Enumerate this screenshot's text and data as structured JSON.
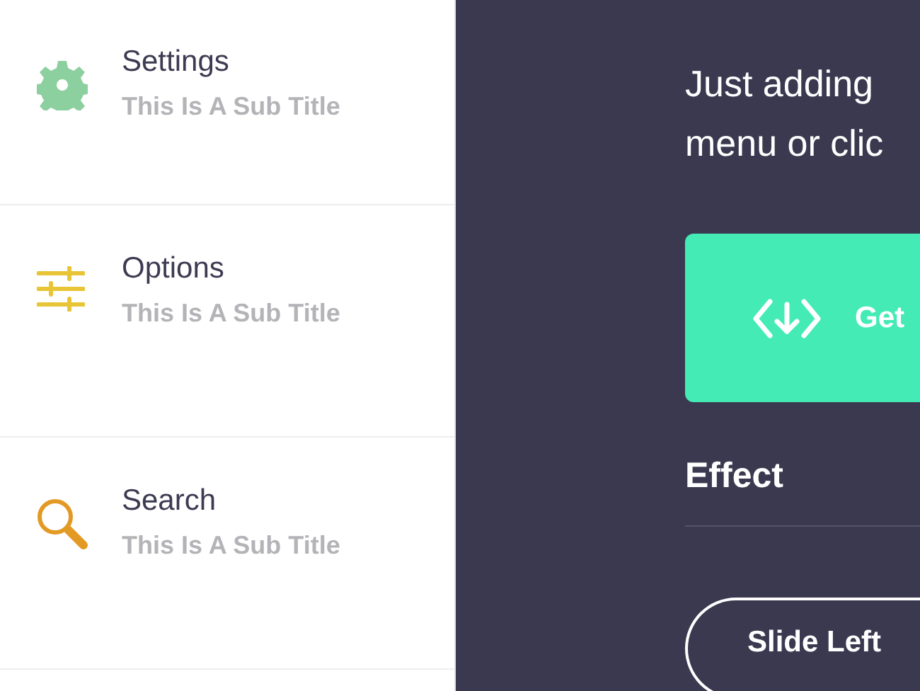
{
  "sidebar": {
    "items": [
      {
        "kind": "gear",
        "title": "Settings",
        "subtitle": "This Is A Sub Title",
        "color": "#8dd0a0"
      },
      {
        "kind": "sliders",
        "title": "Options",
        "subtitle": "This Is A Sub Title",
        "color": "#e8c536"
      },
      {
        "kind": "search",
        "title": "Search",
        "subtitle": "This Is A Sub Title",
        "color": "#e39a25"
      }
    ]
  },
  "main": {
    "intro_lines": [
      "Just adding",
      "menu or clic"
    ],
    "primary_button": {
      "label": "Get"
    },
    "section_heading": "Effect",
    "effect_button": {
      "label": "Slide Left"
    }
  }
}
